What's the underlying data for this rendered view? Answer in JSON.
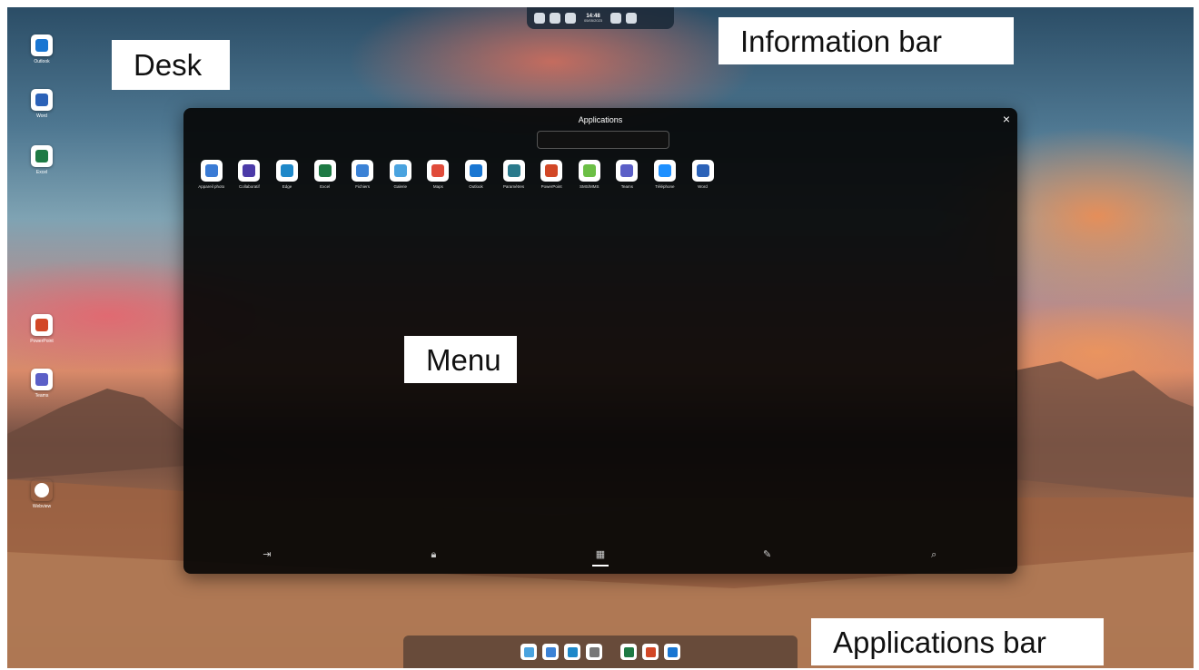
{
  "desktop": {
    "icons": [
      {
        "label": "Outlook",
        "icon": "outlook-icon",
        "color": "#1976d2"
      },
      {
        "label": "Word",
        "icon": "word-icon",
        "color": "#2b62b8"
      },
      {
        "label": "Excel",
        "icon": "excel-icon",
        "color": "#1e7a44"
      },
      {
        "label": "PowerPoint",
        "icon": "powerpoint-icon",
        "color": "#d24726"
      },
      {
        "label": "Teams",
        "icon": "teams-icon",
        "color": "#5b5fc7"
      },
      {
        "label": "Webview",
        "icon": "globe-icon",
        "color": "#ffffff"
      }
    ]
  },
  "callouts": {
    "desk": "Desk",
    "information_bar": "Information bar",
    "menu": "Menu",
    "applications_bar": "Applications bar"
  },
  "infobar": {
    "time": "14:48",
    "date": "05/05/2023"
  },
  "menu": {
    "title": "Applications",
    "close": "×",
    "search_placeholder": "",
    "apps": [
      {
        "label": "Appareil photo",
        "icon": "camera-icon",
        "color": "#3a7bd5"
      },
      {
        "label": "Collaboratif",
        "icon": "play-icon",
        "color": "#4b3aa8"
      },
      {
        "label": "Edge",
        "icon": "edge-icon",
        "color": "#1e88c9"
      },
      {
        "label": "Excel",
        "icon": "excel-icon",
        "color": "#1e7a44"
      },
      {
        "label": "Fichiers",
        "icon": "folder-icon",
        "color": "#3b82d6"
      },
      {
        "label": "Galerie",
        "icon": "gallery-icon",
        "color": "#4aa3df"
      },
      {
        "label": "Maps",
        "icon": "maps-icon",
        "color": "#e04b3a"
      },
      {
        "label": "Outlook",
        "icon": "outlook-icon",
        "color": "#1976d2"
      },
      {
        "label": "Paramètres",
        "icon": "settings-icon",
        "color": "#2a7a8c"
      },
      {
        "label": "PowerPoint",
        "icon": "powerpoint-icon",
        "color": "#d24726"
      },
      {
        "label": "SMS/MMS",
        "icon": "sms-icon",
        "color": "#6bbf45"
      },
      {
        "label": "Teams",
        "icon": "teams-icon",
        "color": "#5b5fc7"
      },
      {
        "label": "Téléphone",
        "icon": "phone-icon",
        "color": "#1e90ff"
      },
      {
        "label": "Word",
        "icon": "word-icon",
        "color": "#2b62b8"
      }
    ],
    "nav": [
      {
        "icon": "exit-icon",
        "glyph": "⇥",
        "active": false
      },
      {
        "icon": "lock-icon",
        "glyph": "🔒︎",
        "active": false
      },
      {
        "icon": "grid-icon",
        "glyph": "▦",
        "active": true
      },
      {
        "icon": "edit-icon",
        "glyph": "✎",
        "active": false
      },
      {
        "icon": "search-icon",
        "glyph": "⌕",
        "active": false
      }
    ]
  },
  "appbar": {
    "apps": [
      {
        "icon": "gallery-icon",
        "color": "#4aa3df"
      },
      {
        "icon": "folder-icon",
        "color": "#3b82d6"
      },
      {
        "icon": "edge-icon",
        "color": "#1e88c9"
      },
      {
        "icon": "recent-icon",
        "color": "#777777"
      },
      {
        "icon": "excel-icon",
        "color": "#1e7a44"
      },
      {
        "icon": "powerpoint-icon",
        "color": "#d24726"
      },
      {
        "icon": "outlook-icon",
        "color": "#1976d2"
      }
    ]
  }
}
